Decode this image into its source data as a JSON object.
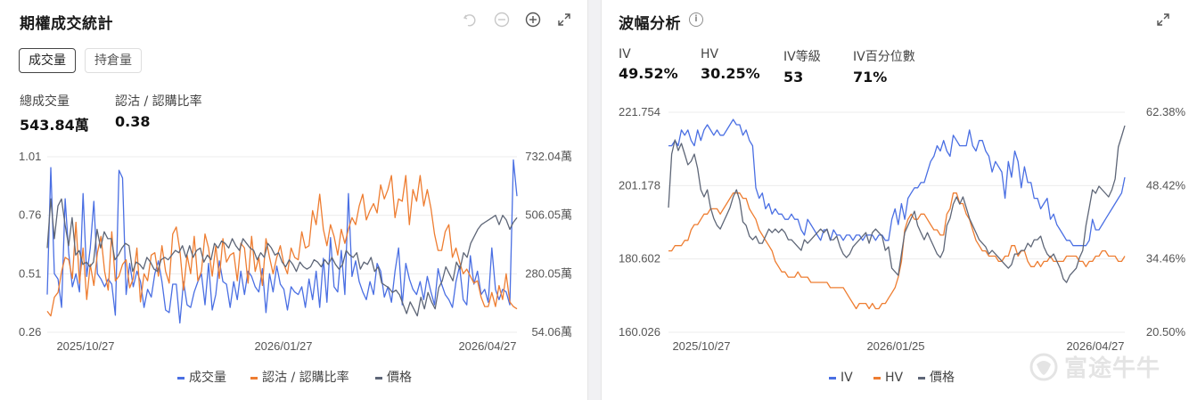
{
  "left": {
    "title": "期權成交統計",
    "tabs": [
      "成交量",
      "持倉量"
    ],
    "stats": [
      {
        "label": "總成交量",
        "value": "543.84萬"
      },
      {
        "label": "認沽 / 認購比率",
        "value": "0.38"
      }
    ]
  },
  "right": {
    "title": "波幅分析",
    "info_icon": "i",
    "stats": [
      {
        "label": "IV",
        "value": "49.52%"
      },
      {
        "label": "HV",
        "value": "30.25%"
      },
      {
        "label": "IV等級",
        "value": "53"
      },
      {
        "label": "IV百分位數",
        "value": "71%"
      }
    ]
  },
  "watermark": "富途牛牛",
  "chart_data": [
    {
      "type": "line",
      "x_labels": [
        "2025/10/27",
        "2026/01/27",
        "2026/04/27"
      ],
      "y_left_ticks": [
        "1.01",
        "0.76",
        "0.51",
        "0.26"
      ],
      "y_right_ticks": [
        "732.04萬",
        "506.05萬",
        "280.05萬",
        "54.06萬"
      ],
      "y_left_range": [
        0.26,
        1.01
      ],
      "y_right_range": [
        54.06,
        732.04
      ],
      "legend": [
        "成交量",
        "認沽 / 認購比率",
        "價格"
      ],
      "legend_position": "bottom",
      "colors": {
        "volume": "#4a6fe3",
        "ratio": "#ee7d31",
        "price": "#5e6677"
      },
      "series": [
        {
          "name": "成交量",
          "axis": "right",
          "values": [
            200,
            690,
            280,
            260,
            150,
            570,
            360,
            230,
            280,
            210,
            590,
            270,
            380,
            560,
            280,
            260,
            230,
            260,
            240,
            120,
            680,
            650,
            200,
            320,
            230,
            290,
            250,
            150,
            220,
            190,
            280,
            330,
            250,
            140,
            130,
            240,
            240,
            90,
            250,
            160,
            150,
            210,
            250,
            280,
            160,
            320,
            140,
            200,
            330,
            250,
            240,
            150,
            250,
            180,
            290,
            200,
            290,
            270,
            230,
            210,
            300,
            130,
            280,
            210,
            310,
            240,
            220,
            140,
            230,
            210,
            200,
            230,
            150,
            260,
            180,
            290,
            150,
            340,
            170,
            420,
            230,
            210,
            370,
            200,
            590,
            270,
            330,
            250,
            210,
            180,
            250,
            200,
            320,
            290,
            190,
            230,
            170,
            290,
            380,
            160,
            320,
            260,
            220,
            200,
            250,
            180,
            270,
            210,
            160,
            300,
            240,
            200,
            180,
            150,
            250,
            310,
            180,
            160,
            350,
            240,
            290,
            200,
            220,
            170,
            380,
            220,
            180,
            220,
            210,
            160,
            720,
            580
          ]
        },
        {
          "name": "認沽 / 認購比率",
          "axis": "left",
          "values": [
            0.35,
            0.33,
            0.41,
            0.43,
            0.52,
            0.58,
            0.57,
            0.49,
            0.73,
            0.47,
            0.62,
            0.4,
            0.55,
            0.46,
            0.6,
            0.67,
            0.52,
            0.44,
            0.69,
            0.48,
            0.5,
            0.55,
            0.57,
            0.45,
            0.49,
            0.62,
            0.39,
            0.51,
            0.48,
            0.59,
            0.6,
            0.5,
            0.63,
            0.52,
            0.47,
            0.68,
            0.71,
            0.61,
            0.44,
            0.59,
            0.51,
            0.67,
            0.48,
            0.52,
            0.68,
            0.62,
            0.5,
            0.63,
            0.49,
            0.66,
            0.56,
            0.59,
            0.6,
            0.48,
            0.64,
            0.62,
            0.47,
            0.67,
            0.52,
            0.58,
            0.46,
            0.66,
            0.58,
            0.51,
            0.58,
            0.63,
            0.55,
            0.51,
            0.62,
            0.58,
            0.57,
            0.69,
            0.62,
            0.63,
            0.78,
            0.72,
            0.85,
            0.7,
            0.63,
            0.72,
            0.67,
            0.59,
            0.7,
            0.64,
            0.7,
            0.75,
            0.72,
            0.8,
            0.85,
            0.74,
            0.78,
            0.81,
            0.77,
            0.89,
            0.83,
            0.87,
            0.93,
            0.75,
            0.83,
            0.82,
            0.93,
            0.72,
            0.87,
            0.82,
            0.93,
            0.8,
            0.87,
            0.79,
            0.68,
            0.61,
            0.61,
            0.69,
            0.72,
            0.58,
            0.62,
            0.56,
            0.51,
            0.53,
            0.5,
            0.47,
            0.48,
            0.41,
            0.37,
            0.37,
            0.43,
            0.37,
            0.46,
            0.4,
            0.51,
            0.39,
            0.37,
            0.36
          ]
        },
        {
          "name": "價格",
          "axis": "left",
          "values": [
            0.62,
            0.83,
            0.66,
            0.8,
            0.83,
            0.72,
            0.63,
            0.75,
            0.59,
            0.61,
            0.55,
            0.56,
            0.54,
            0.56,
            0.7,
            0.62,
            0.69,
            0.66,
            0.66,
            0.57,
            0.59,
            0.62,
            0.64,
            0.63,
            0.52,
            0.56,
            0.55,
            0.53,
            0.58,
            0.56,
            0.53,
            0.52,
            0.57,
            0.58,
            0.57,
            0.59,
            0.61,
            0.6,
            0.63,
            0.58,
            0.63,
            0.58,
            0.61,
            0.62,
            0.56,
            0.59,
            0.57,
            0.64,
            0.62,
            0.65,
            0.64,
            0.62,
            0.66,
            0.63,
            0.61,
            0.66,
            0.64,
            0.62,
            0.61,
            0.57,
            0.6,
            0.58,
            0.64,
            0.62,
            0.59,
            0.6,
            0.56,
            0.54,
            0.57,
            0.55,
            0.52,
            0.56,
            0.54,
            0.53,
            0.54,
            0.57,
            0.56,
            0.54,
            0.57,
            0.55,
            0.58,
            0.55,
            0.53,
            0.55,
            0.61,
            0.59,
            0.58,
            0.6,
            0.53,
            0.56,
            0.55,
            0.58,
            0.52,
            0.54,
            0.47,
            0.46,
            0.45,
            0.43,
            0.44,
            0.42,
            0.38,
            0.34,
            0.39,
            0.36,
            0.33,
            0.41,
            0.36,
            0.43,
            0.39,
            0.36,
            0.45,
            0.48,
            0.54,
            0.51,
            0.48,
            0.56,
            0.53,
            0.6,
            0.58,
            0.64,
            0.67,
            0.7,
            0.72,
            0.73,
            0.74,
            0.75,
            0.76,
            0.72,
            0.76,
            0.74,
            0.7,
            0.73,
            0.75
          ]
        }
      ]
    },
    {
      "type": "line",
      "x_labels": [
        "2025/10/27",
        "2026/01/25",
        "2026/04/27"
      ],
      "y_left_ticks": [
        "221.754",
        "201.178",
        "180.602",
        "160.026"
      ],
      "y_right_ticks": [
        "62.38%",
        "48.42%",
        "34.46%",
        "20.50%"
      ],
      "y_left_range": [
        160.026,
        221.754
      ],
      "y_right_range": [
        20.5,
        62.38
      ],
      "legend": [
        "IV",
        "HV",
        "價格"
      ],
      "legend_position": "bottom",
      "colors": {
        "iv": "#4a6fe3",
        "hv": "#ee7d31",
        "price": "#5e6677"
      },
      "series": [
        {
          "name": "IV",
          "axis": "right",
          "values": [
            56,
            56,
            57,
            56,
            59,
            58,
            59,
            57,
            56,
            59,
            57,
            59,
            60,
            59,
            58,
            59,
            58,
            58,
            59,
            60,
            61,
            60,
            60,
            58,
            59,
            57,
            56,
            48,
            46,
            47,
            44,
            45,
            43,
            44,
            43,
            43,
            42,
            42,
            43,
            42,
            42,
            40,
            39,
            42,
            41,
            40,
            39,
            38,
            40,
            40,
            38,
            40,
            39,
            39,
            38,
            39,
            39,
            38,
            39,
            39,
            38,
            39,
            39,
            39,
            38,
            39,
            39,
            38,
            38,
            42,
            44,
            41,
            45,
            42,
            46,
            47,
            48,
            48,
            49,
            49,
            51,
            53,
            54,
            56,
            55,
            57,
            55,
            54,
            58,
            57,
            56,
            56,
            56,
            59,
            56,
            55,
            57,
            57,
            55,
            54,
            51,
            53,
            52,
            51,
            46,
            53,
            50,
            55,
            53,
            48,
            52,
            49,
            49,
            46,
            46,
            44,
            45,
            46,
            42,
            43,
            41,
            40,
            39,
            38,
            38,
            37,
            37,
            37,
            37,
            37,
            38,
            42,
            40,
            40,
            41,
            42,
            43,
            44,
            45,
            46,
            47,
            50
          ]
        },
        {
          "name": "HV",
          "axis": "right",
          "values": [
            36,
            36,
            37,
            37,
            37,
            38,
            38,
            40,
            41,
            41,
            42,
            43,
            43,
            44,
            44,
            44,
            43,
            44,
            45,
            46,
            47,
            47,
            47,
            46,
            46,
            44,
            43,
            42,
            40,
            39,
            38,
            37,
            36,
            34,
            33,
            32,
            32,
            31,
            31,
            31,
            32,
            31,
            31,
            31,
            30,
            30,
            30,
            30,
            30,
            30,
            29,
            29,
            29,
            29,
            29,
            28,
            27,
            26,
            25,
            26,
            26,
            26,
            25,
            26,
            25,
            25,
            26,
            26,
            27,
            28,
            29,
            31,
            34,
            40,
            42,
            43,
            42,
            42,
            43,
            43,
            42,
            41,
            40,
            40,
            39,
            39,
            43,
            44,
            47,
            47,
            45,
            45,
            43,
            42,
            40,
            38,
            37,
            36,
            36,
            35,
            35,
            35,
            34,
            34,
            35,
            35,
            37,
            37,
            35,
            36,
            36,
            34,
            33,
            33,
            34,
            33,
            34,
            34,
            35,
            34,
            34,
            34,
            34,
            35,
            35,
            35,
            35,
            34,
            34,
            33,
            34,
            34,
            35,
            35,
            36,
            36,
            35,
            35,
            35,
            34,
            34,
            35
          ]
        },
        {
          "name": "價格",
          "axis": "left",
          "values": [
            195,
            210,
            214,
            211,
            213,
            210,
            207,
            208,
            210,
            206,
            200,
            198,
            200,
            195,
            192,
            190,
            189,
            191,
            193,
            195,
            198,
            200,
            197,
            191,
            190,
            187,
            186,
            187,
            185,
            185,
            187,
            189,
            188,
            189,
            188,
            189,
            188,
            186,
            186,
            185,
            184,
            183,
            186,
            185,
            186,
            187,
            188,
            189,
            188,
            189,
            186,
            186,
            187,
            184,
            182,
            181,
            182,
            184,
            185,
            186,
            187,
            188,
            185,
            188,
            189,
            188,
            187,
            183,
            184,
            178,
            177,
            176,
            182,
            188,
            190,
            192,
            194,
            190,
            188,
            186,
            188,
            186,
            184,
            182,
            181,
            183,
            190,
            192,
            196,
            198,
            196,
            198,
            195,
            192,
            190,
            188,
            186,
            185,
            184,
            182,
            183,
            182,
            181,
            180,
            179,
            178,
            179,
            182,
            182,
            183,
            183,
            185,
            184,
            186,
            186,
            187,
            184,
            182,
            181,
            182,
            180,
            178,
            175,
            174,
            176,
            177,
            178,
            181,
            183,
            190,
            195,
            200,
            199,
            201,
            200,
            199,
            198,
            200,
            203,
            212,
            215,
            218
          ]
        }
      ]
    }
  ]
}
